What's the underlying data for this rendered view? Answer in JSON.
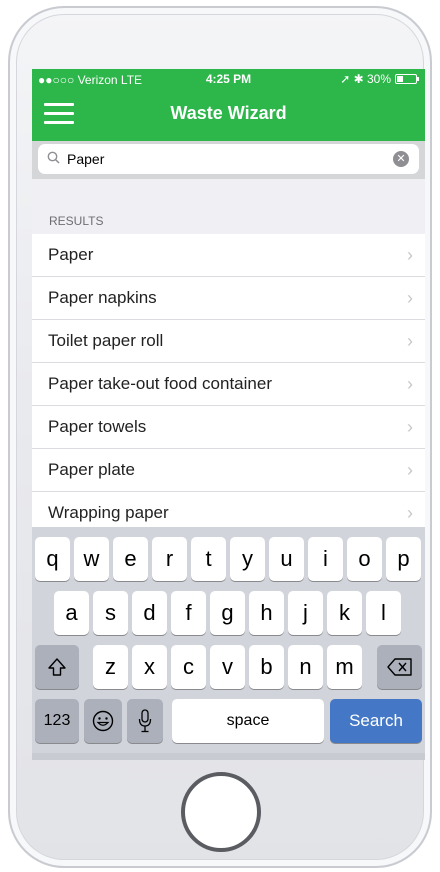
{
  "status_bar": {
    "carrier": "●●○○○ Verizon  LTE",
    "time": "4:25 PM",
    "right_text": "➚ ✱ 30%"
  },
  "header": {
    "title": "Waste Wizard"
  },
  "search": {
    "value": "Paper",
    "icon": "search-icon"
  },
  "results": {
    "section_title": "RESULTS",
    "items": [
      {
        "label": "Paper"
      },
      {
        "label": "Paper napkins"
      },
      {
        "label": "Toilet paper roll"
      },
      {
        "label": "Paper take-out food container"
      },
      {
        "label": "Paper towels"
      },
      {
        "label": "Paper plate"
      },
      {
        "label": "Wrapping paper"
      }
    ]
  },
  "keyboard": {
    "row1": [
      "q",
      "w",
      "e",
      "r",
      "t",
      "y",
      "u",
      "i",
      "o",
      "p"
    ],
    "row2": [
      "a",
      "s",
      "d",
      "f",
      "g",
      "h",
      "j",
      "k",
      "l"
    ],
    "row3": [
      "z",
      "x",
      "c",
      "v",
      "b",
      "n",
      "m"
    ],
    "numbers_label": "123",
    "space_label": "space",
    "search_label": "Search"
  },
  "colors": {
    "brand_green": "#2db64a",
    "search_key_blue": "#4477c5"
  }
}
